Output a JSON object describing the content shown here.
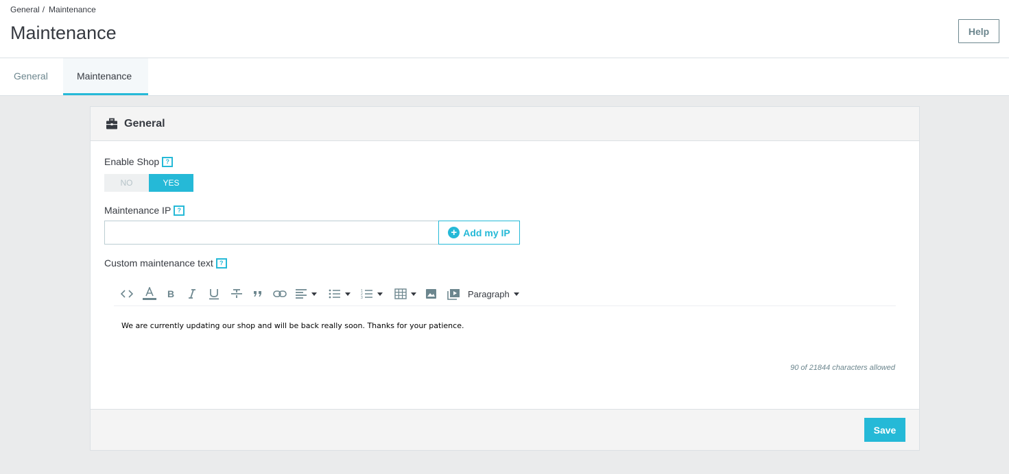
{
  "breadcrumb": {
    "items": [
      "General",
      "Maintenance"
    ],
    "separator": "/"
  },
  "page_title": "Maintenance",
  "help_label": "Help",
  "tabs": [
    {
      "label": "General",
      "active": false
    },
    {
      "label": "Maintenance",
      "active": true
    }
  ],
  "panel": {
    "title": "General",
    "icon": "briefcase-icon",
    "enable_shop": {
      "label": "Enable Shop",
      "help": "?",
      "options": [
        "NO",
        "YES"
      ],
      "selected": "YES"
    },
    "maintenance_ip": {
      "label": "Maintenance IP",
      "help": "?",
      "value": "",
      "add_button_label": "Add my IP"
    },
    "custom_text": {
      "label": "Custom maintenance text",
      "help": "?",
      "toolbar": {
        "items": [
          "code-view-icon",
          "text-color-icon",
          "bold-icon",
          "italic-icon",
          "underline-icon",
          "strikethrough-icon",
          "blockquote-icon",
          "link-icon",
          "align-icon",
          "bullet-list-icon",
          "numbered-list-icon",
          "table-icon",
          "image-icon",
          "video-icon"
        ],
        "paragraph_label": "Paragraph"
      },
      "content": "We are currently updating our shop and will be back really soon. Thanks for your patience.",
      "counter": "90 of 21844 characters allowed"
    },
    "save_label": "Save"
  },
  "colors": {
    "accent": "#25b9d7",
    "text": "#363a41",
    "muted": "#6c868e",
    "background": "#eaebec"
  }
}
